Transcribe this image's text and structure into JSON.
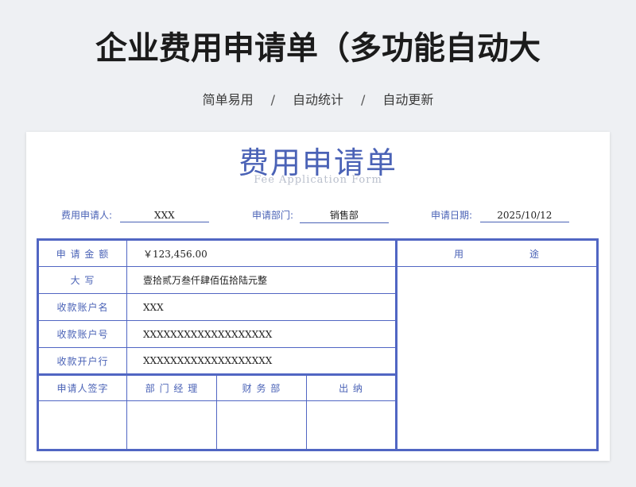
{
  "header": {
    "title": "企业费用申请单（多功能自动大",
    "subtitle_items": [
      "简单易用",
      "自动统计",
      "自动更新"
    ],
    "separator": "/"
  },
  "form": {
    "title": "费用申请单",
    "subtitle": "Fee Application Form",
    "applicant_label": "费用申请人:",
    "applicant_value": "XXX",
    "department_label": "申请部门:",
    "department_value": "销售部",
    "date_label": "申请日期:",
    "date_value": "2025/10/12",
    "rows": [
      {
        "label": "申 请 金 额",
        "value": "￥123,456.00"
      },
      {
        "label": "大      写",
        "value": "壹拾贰万叁仟肆佰伍拾陆元整"
      },
      {
        "label": "收款账户名",
        "value": "XXX"
      },
      {
        "label": "收款账户号",
        "value": "XXXXXXXXXXXXXXXXXXX"
      },
      {
        "label": "收款开户行",
        "value": "XXXXXXXXXXXXXXXXXXX"
      }
    ],
    "purpose_label_1": "用",
    "purpose_label_2": "途",
    "sign_headers": [
      "申请人签字",
      "部 门 经 理",
      "财   务   部",
      "出      纳"
    ]
  }
}
